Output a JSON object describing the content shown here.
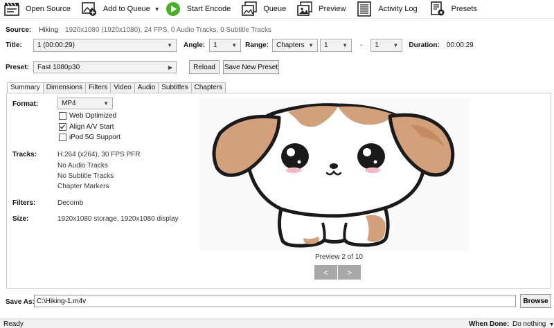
{
  "toolbar": {
    "open_source": "Open Source",
    "add_to_queue": "Add to Queue",
    "start_encode": "Start Encode",
    "queue": "Queue",
    "preview": "Preview",
    "activity_log": "Activity Log",
    "presets": "Presets"
  },
  "source": {
    "label": "Source:",
    "name": "Hiking",
    "details": "1920x1080 (1920x1080), 24 FPS, 0 Audio Tracks, 0 Subtitle Tracks"
  },
  "title_row": {
    "title_label": "Title:",
    "title_value": "1 (00:00:29)",
    "angle_label": "Angle:",
    "angle_value": "1",
    "range_label": "Range:",
    "range_type": "Chapters",
    "range_start": "1",
    "range_sep": "-",
    "range_end": "1",
    "duration_label": "Duration:",
    "duration_value": "00:00:29"
  },
  "preset_row": {
    "label": "Preset:",
    "value": "Fast 1080p30",
    "reload": "Reload",
    "save_new": "Save New Preset"
  },
  "tabs": [
    "Summary",
    "Dimensions",
    "Filters",
    "Video",
    "Audio",
    "Subtitles",
    "Chapters"
  ],
  "summary": {
    "format_label": "Format:",
    "format_value": "MP4",
    "web_optimized": "Web Optimized",
    "web_optimized_checked": false,
    "align_av": "Align A/V Start",
    "align_av_checked": true,
    "ipod": "iPod 5G Support",
    "ipod_checked": false,
    "tracks_label": "Tracks:",
    "tracks": [
      "H.264 (x264), 30 FPS PFR",
      "No Audio Tracks",
      "No Subtitle Tracks",
      "Chapter Markers"
    ],
    "filters_label": "Filters:",
    "filters_value": "Decomb",
    "size_label": "Size:",
    "size_value": "1920x1080 storage, 1920x1080 display"
  },
  "preview": {
    "caption": "Preview 2 of 10",
    "prev": "<",
    "next": ">"
  },
  "save_as": {
    "label": "Save As:",
    "value": "C:\\Hiking-1.m4v",
    "browse": "Browse"
  },
  "status": {
    "text": "Ready",
    "when_done_label": "When Done:",
    "when_done_value": "Do nothing"
  },
  "colors": {
    "play_green": "#4caf2b",
    "dog_brown": "#d2a07a",
    "dog_outline": "#1a1a1a",
    "blush": "#f4b8c3"
  }
}
